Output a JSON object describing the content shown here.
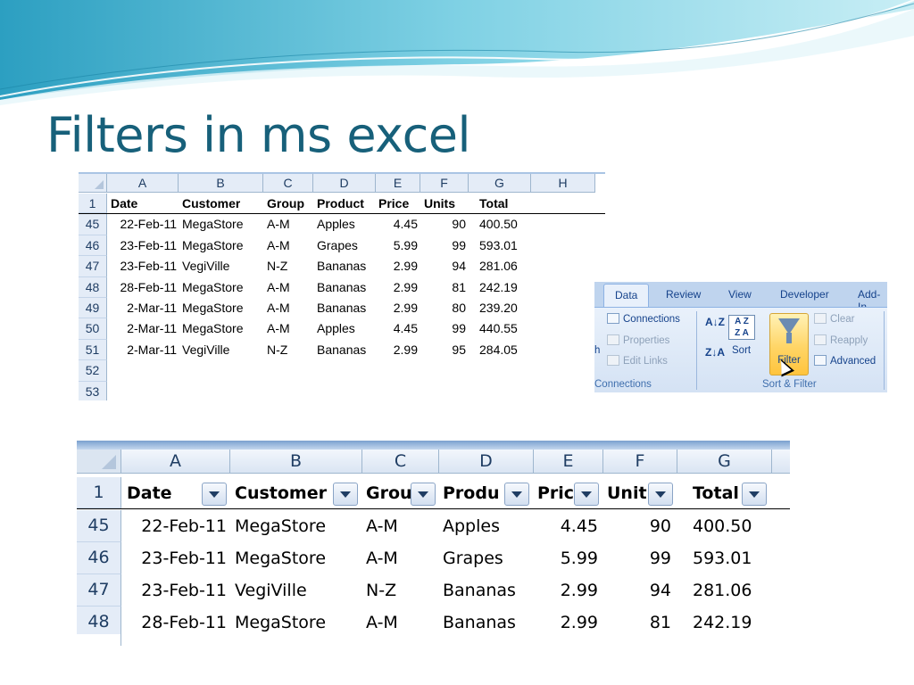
{
  "slide": {
    "title": "Filters in ms excel"
  },
  "sheet_small": {
    "columns": [
      "A",
      "B",
      "C",
      "D",
      "E",
      "F",
      "G",
      "H"
    ],
    "header_row": {
      "num": "1",
      "cells": [
        "Date",
        "Customer",
        "Group",
        "Product",
        "Price",
        "Units",
        "Total"
      ]
    },
    "rows": [
      {
        "num": "45",
        "cells": [
          "22-Feb-11",
          "MegaStore",
          "A-M",
          "Apples",
          "4.45",
          "90",
          "400.50"
        ]
      },
      {
        "num": "46",
        "cells": [
          "23-Feb-11",
          "MegaStore",
          "A-M",
          "Grapes",
          "5.99",
          "99",
          "593.01"
        ]
      },
      {
        "num": "47",
        "cells": [
          "23-Feb-11",
          "VegiVille",
          "N-Z",
          "Bananas",
          "2.99",
          "94",
          "281.06"
        ]
      },
      {
        "num": "48",
        "cells": [
          "28-Feb-11",
          "MegaStore",
          "A-M",
          "Bananas",
          "2.99",
          "81",
          "242.19"
        ]
      },
      {
        "num": "49",
        "cells": [
          "2-Mar-11",
          "MegaStore",
          "A-M",
          "Bananas",
          "2.99",
          "80",
          "239.20"
        ]
      },
      {
        "num": "50",
        "cells": [
          "2-Mar-11",
          "MegaStore",
          "A-M",
          "Apples",
          "4.45",
          "99",
          "440.55"
        ]
      },
      {
        "num": "51",
        "cells": [
          "2-Mar-11",
          "VegiVille",
          "N-Z",
          "Bananas",
          "2.99",
          "95",
          "284.05"
        ]
      }
    ],
    "empty_rows": [
      "52",
      "53"
    ]
  },
  "ribbon": {
    "tabs": [
      "Data",
      "Review",
      "View",
      "Developer",
      "Add-In"
    ],
    "active_tab": "Data",
    "connections": {
      "items": [
        "Connections",
        "Properties",
        "Edit Links"
      ],
      "group_label": "Connections",
      "partial_left": "h"
    },
    "sort_filter": {
      "sort_label": "Sort",
      "az_top": "A Z",
      "az_bottom": "Z A",
      "asc_arrow": "A↓Z",
      "desc_arrow": "Z↓A",
      "filter_label": "Filter",
      "clear_label": "Clear",
      "reapply_label": "Reapply",
      "advanced_label": "Advanced",
      "group_label": "Sort & Filter"
    },
    "colors": {
      "filter_active": "#ffd566",
      "tab_bar": "#bfd4ee",
      "text": "#15428b"
    }
  },
  "sheet_large": {
    "columns": [
      "A",
      "B",
      "C",
      "D",
      "E",
      "F",
      "G"
    ],
    "header_row": {
      "num": "1",
      "cells": [
        "Date",
        "Customer",
        "Grou",
        "Produ",
        "Pric",
        "Unit",
        "Total"
      ]
    },
    "rows": [
      {
        "num": "45",
        "cells": [
          "22-Feb-11",
          "MegaStore",
          "A-M",
          "Apples",
          "4.45",
          "90",
          "400.50"
        ]
      },
      {
        "num": "46",
        "cells": [
          "23-Feb-11",
          "MegaStore",
          "A-M",
          "Grapes",
          "5.99",
          "99",
          "593.01"
        ]
      },
      {
        "num": "47",
        "cells": [
          "23-Feb-11",
          "VegiVille",
          "N-Z",
          "Bananas",
          "2.99",
          "94",
          "281.06"
        ]
      },
      {
        "num": "48",
        "cells": [
          "28-Feb-11",
          "MegaStore",
          "A-M",
          "Bananas",
          "2.99",
          "81",
          "242.19"
        ]
      }
    ]
  },
  "colors": {
    "title": "#17607a",
    "header_fill": "#e4ecf7",
    "grid_border": "#9eb6ce"
  }
}
